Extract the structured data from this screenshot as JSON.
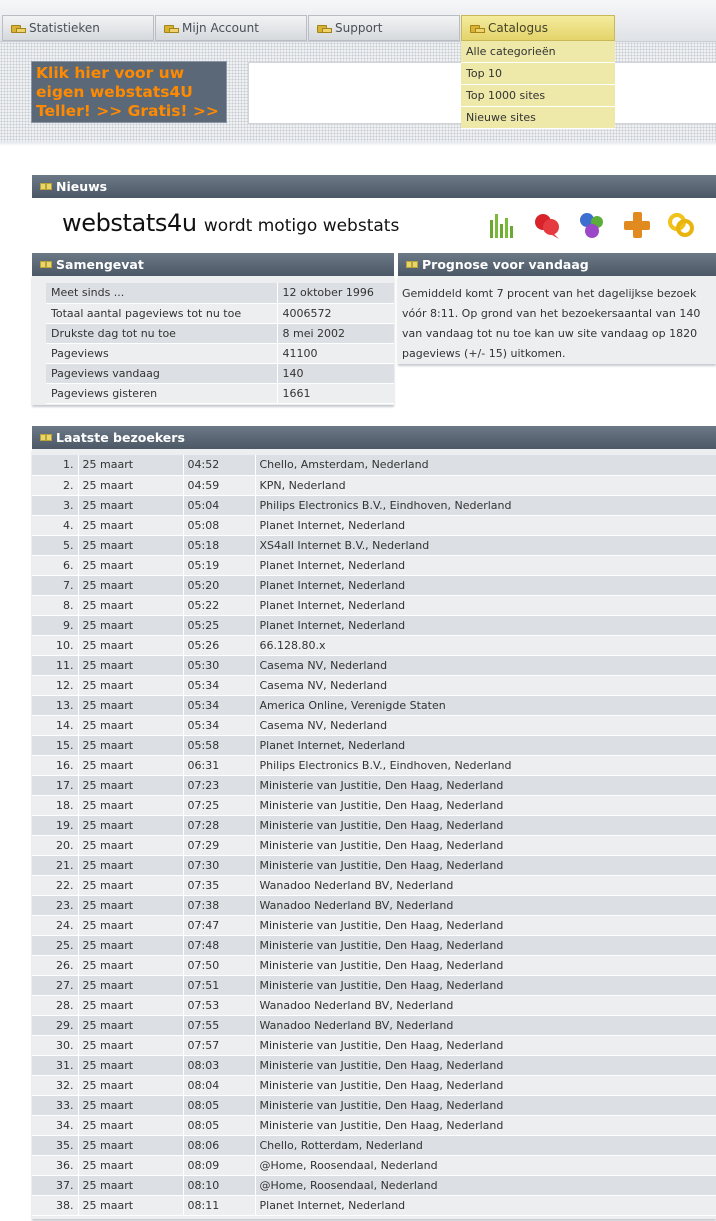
{
  "nav": {
    "tabs": [
      {
        "label": "Statistieken",
        "active": false
      },
      {
        "label": "Mijn Account",
        "active": false
      },
      {
        "label": "Support",
        "active": false
      },
      {
        "label": "Catalogus",
        "active": true
      }
    ],
    "dropdown": [
      "Alle categorieën",
      "Top 10",
      "Top 1000 sites",
      "Nieuwe sites"
    ]
  },
  "promo": {
    "line1": "Klik hier voor uw",
    "line2": "eigen webstats4U",
    "line3": "Teller! >> Gratis! >>"
  },
  "nieuws": {
    "title": "Nieuws",
    "headline_brand": "webstats4u",
    "headline_mid": "wordt motigo webstats",
    "icons": [
      "bar-chart-icon",
      "chat-bubbles-icon",
      "color-dots-icon",
      "plus-icon",
      "link-icon"
    ]
  },
  "samengevat": {
    "title": "Samengevat",
    "rows": [
      {
        "label": "Meet sinds ...",
        "value": "12 oktober 1996"
      },
      {
        "label": "Totaal aantal pageviews tot nu toe",
        "value": "4006572"
      },
      {
        "label": "Drukste dag tot nu toe",
        "value": "8 mei 2002"
      },
      {
        "label": "Pageviews",
        "value": "41100"
      },
      {
        "label": "Pageviews vandaag",
        "value": "140"
      },
      {
        "label": "Pageviews gisteren",
        "value": "1661"
      }
    ]
  },
  "prognose": {
    "title": "Prognose voor vandaag",
    "text": "Gemiddeld komt 7 procent van het dagelijkse bezoek vóór 8:11. Op grond van het bezoekersaantal van 140 van vandaag tot nu toe kan uw site vandaag op 1820 pageviews (+/- 15) uitkomen."
  },
  "bezoekers": {
    "title": "Laatste bezoekers",
    "rows": [
      [
        "1.",
        "25 maart",
        "04:52",
        "Chello, Amsterdam, Nederland"
      ],
      [
        "2.",
        "25 maart",
        "04:59",
        "KPN, Nederland"
      ],
      [
        "3.",
        "25 maart",
        "05:04",
        "Philips Electronics B.V., Eindhoven, Nederland"
      ],
      [
        "4.",
        "25 maart",
        "05:08",
        "Planet Internet, Nederland"
      ],
      [
        "5.",
        "25 maart",
        "05:18",
        "XS4all Internet B.V., Nederland"
      ],
      [
        "6.",
        "25 maart",
        "05:19",
        "Planet Internet, Nederland"
      ],
      [
        "7.",
        "25 maart",
        "05:20",
        "Planet Internet, Nederland"
      ],
      [
        "8.",
        "25 maart",
        "05:22",
        "Planet Internet, Nederland"
      ],
      [
        "9.",
        "25 maart",
        "05:25",
        "Planet Internet, Nederland"
      ],
      [
        "10.",
        "25 maart",
        "05:26",
        "66.128.80.x"
      ],
      [
        "11.",
        "25 maart",
        "05:30",
        "Casema NV, Nederland"
      ],
      [
        "12.",
        "25 maart",
        "05:34",
        "Casema NV, Nederland"
      ],
      [
        "13.",
        "25 maart",
        "05:34",
        "America Online, Verenigde Staten"
      ],
      [
        "14.",
        "25 maart",
        "05:34",
        "Casema NV, Nederland"
      ],
      [
        "15.",
        "25 maart",
        "05:58",
        "Planet Internet, Nederland"
      ],
      [
        "16.",
        "25 maart",
        "06:31",
        "Philips Electronics B.V., Eindhoven, Nederland"
      ],
      [
        "17.",
        "25 maart",
        "07:23",
        "Ministerie van Justitie, Den Haag, Nederland"
      ],
      [
        "18.",
        "25 maart",
        "07:25",
        "Ministerie van Justitie, Den Haag, Nederland"
      ],
      [
        "19.",
        "25 maart",
        "07:28",
        "Ministerie van Justitie, Den Haag, Nederland"
      ],
      [
        "20.",
        "25 maart",
        "07:29",
        "Ministerie van Justitie, Den Haag, Nederland"
      ],
      [
        "21.",
        "25 maart",
        "07:30",
        "Ministerie van Justitie, Den Haag, Nederland"
      ],
      [
        "22.",
        "25 maart",
        "07:35",
        "Wanadoo Nederland BV, Nederland"
      ],
      [
        "23.",
        "25 maart",
        "07:38",
        "Wanadoo Nederland BV, Nederland"
      ],
      [
        "24.",
        "25 maart",
        "07:47",
        "Ministerie van Justitie, Den Haag, Nederland"
      ],
      [
        "25.",
        "25 maart",
        "07:48",
        "Ministerie van Justitie, Den Haag, Nederland"
      ],
      [
        "26.",
        "25 maart",
        "07:50",
        "Ministerie van Justitie, Den Haag, Nederland"
      ],
      [
        "27.",
        "25 maart",
        "07:51",
        "Ministerie van Justitie, Den Haag, Nederland"
      ],
      [
        "28.",
        "25 maart",
        "07:53",
        "Wanadoo Nederland BV, Nederland"
      ],
      [
        "29.",
        "25 maart",
        "07:55",
        "Wanadoo Nederland BV, Nederland"
      ],
      [
        "30.",
        "25 maart",
        "07:57",
        "Ministerie van Justitie, Den Haag, Nederland"
      ],
      [
        "31.",
        "25 maart",
        "08:03",
        "Ministerie van Justitie, Den Haag, Nederland"
      ],
      [
        "32.",
        "25 maart",
        "08:04",
        "Ministerie van Justitie, Den Haag, Nederland"
      ],
      [
        "33.",
        "25 maart",
        "08:05",
        "Ministerie van Justitie, Den Haag, Nederland"
      ],
      [
        "34.",
        "25 maart",
        "08:05",
        "Ministerie van Justitie, Den Haag, Nederland"
      ],
      [
        "35.",
        "25 maart",
        "08:06",
        "Chello, Rotterdam, Nederland"
      ],
      [
        "36.",
        "25 maart",
        "08:09",
        "@Home, Roosendaal, Nederland"
      ],
      [
        "37.",
        "25 maart",
        "08:10",
        "@Home, Roosendaal, Nederland"
      ],
      [
        "38.",
        "25 maart",
        "08:11",
        "Planet Internet, Nederland"
      ]
    ]
  },
  "colors": {
    "panel_header": "#5a6674",
    "active_tab": "#e8d97a",
    "dropdown": "#eee9a8",
    "promo_text": "#ff8a00",
    "row_odd": "#dcdfe3",
    "row_even": "#eceef0"
  }
}
